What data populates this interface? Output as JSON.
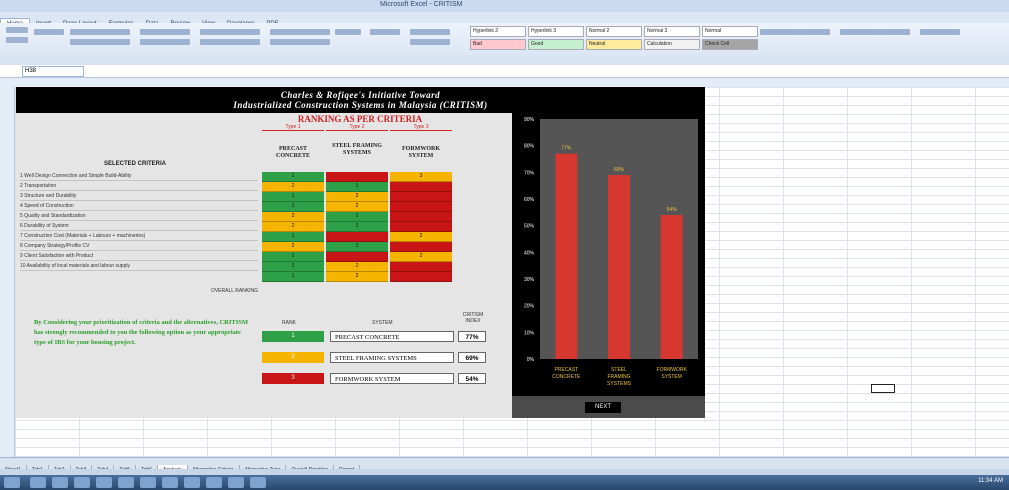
{
  "window": {
    "title": "Microsoft Excel - CRITISM"
  },
  "ribbon_tabs": [
    "Home",
    "Insert",
    "Page Layout",
    "Formulas",
    "Data",
    "Review",
    "View",
    "Developer",
    "PDF"
  ],
  "ribbon_styles": [
    "Hyperlink 2",
    "Hyperlink 3",
    "Normal 2",
    "Normal 3",
    "Normal",
    "Bad",
    "Good",
    "Neutral",
    "Calculation",
    "Check Cell"
  ],
  "name_box": "H38",
  "header": {
    "line1": "Charles & Rofiqee's Initiative Toward",
    "line2": "Industrialized Construction Systems in Malaysia (CRITISM)"
  },
  "ranking": {
    "title": "RANKING AS PER CRITERIA",
    "type_labels": [
      "Type 1",
      "Type 2",
      "Type 3"
    ],
    "systems": [
      "PRECAST CONCRETE",
      "STEEL FRAMING SYSTEMS",
      "FORMWORK SYSTEM"
    ],
    "selected_criteria_label": "SELECTED CRITERIA",
    "overall_label": "OVERALL RANKING",
    "criteria": [
      "1 Well Design Connection and Simple Build-Ability",
      "2 Transportation",
      "3 Structure and Durability",
      "4 Speed of Construction",
      "5 Quality and Standardization",
      "6 Durability of System",
      "7 Construction Cost (Materials + Labours + machineries)",
      "8 Company Strategy/Profile CV",
      "9 Client Satisfaction with Product",
      "10 Availability of local materials and labour supply"
    ],
    "rows": [
      [
        {
          "c": "g",
          "v": "1"
        },
        {
          "c": "r",
          "v": ""
        },
        {
          "c": "y",
          "v": "3"
        }
      ],
      [
        {
          "c": "y",
          "v": "2"
        },
        {
          "c": "g",
          "v": "1"
        },
        {
          "c": "r",
          "v": ""
        }
      ],
      [
        {
          "c": "g",
          "v": "1"
        },
        {
          "c": "y",
          "v": "2"
        },
        {
          "c": "r",
          "v": ""
        }
      ],
      [
        {
          "c": "g",
          "v": "1"
        },
        {
          "c": "y",
          "v": "2"
        },
        {
          "c": "r",
          "v": ""
        }
      ],
      [
        {
          "c": "y",
          "v": "2"
        },
        {
          "c": "g",
          "v": "1"
        },
        {
          "c": "r",
          "v": ""
        }
      ],
      [
        {
          "c": "y",
          "v": "2"
        },
        {
          "c": "g",
          "v": "1"
        },
        {
          "c": "r",
          "v": ""
        }
      ],
      [
        {
          "c": "g",
          "v": "1"
        },
        {
          "c": "r",
          "v": ""
        },
        {
          "c": "y",
          "v": "2"
        }
      ],
      [
        {
          "c": "y",
          "v": "2"
        },
        {
          "c": "g",
          "v": "1"
        },
        {
          "c": "r",
          "v": ""
        }
      ],
      [
        {
          "c": "g",
          "v": "1"
        },
        {
          "c": "r",
          "v": ""
        },
        {
          "c": "y",
          "v": "2"
        }
      ],
      [
        {
          "c": "g",
          "v": "1"
        },
        {
          "c": "y",
          "v": "2"
        },
        {
          "c": "r",
          "v": ""
        }
      ],
      [
        {
          "c": "g",
          "v": "1"
        },
        {
          "c": "y",
          "v": "2"
        },
        {
          "c": "r",
          "v": ""
        }
      ]
    ]
  },
  "recommendation": {
    "text": "By Considering your prioritization of criteria and the alternatives, CRITISM has strongly recommended to you the following option as your appropriate type of IBS for your housing project.",
    "rank_header": "RANK",
    "system_header": "SYSTEM",
    "index_header": "CRITISM INDEX",
    "items": [
      {
        "rank": "1",
        "name": "PRECAST CONCRETE",
        "pct": "77%",
        "color": "#2ea048"
      },
      {
        "rank": "2",
        "name": "STEEL FRAMING SYSTEMS",
        "pct": "69%",
        "color": "#f4b400"
      },
      {
        "rank": "3",
        "name": "FORMWORK SYSTEM",
        "pct": "54%",
        "color": "#c91515"
      }
    ]
  },
  "next_button": "NEXT",
  "sheet_tabs": [
    "Sheet1",
    "Tab1",
    "Tab2",
    "Tab3",
    "Tab4",
    "Tab5",
    "Tab6",
    "Analysis",
    "Alternative Criteria",
    "Alternative Type",
    "Overall Priorities",
    "Report"
  ],
  "clock": "11:34 AM",
  "chart_data": {
    "type": "bar",
    "categories": [
      "PRECAST CONCRETE",
      "STEEL FRAMING SYSTEMS",
      "FORMWORK SYSTEM"
    ],
    "values": [
      77,
      69,
      54
    ],
    "data_labels": [
      "77%",
      "69%",
      "54%"
    ],
    "ylim": [
      0,
      90
    ],
    "yticks": [
      "0%",
      "10%",
      "20%",
      "30%",
      "40%",
      "50%",
      "60%",
      "70%",
      "80%",
      "90%"
    ],
    "bar_color": "#d6372f",
    "label_color": "#e8c33a"
  }
}
